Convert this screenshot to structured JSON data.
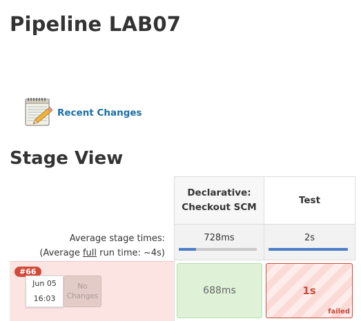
{
  "page": {
    "title": "Pipeline LAB07"
  },
  "recent_changes": {
    "label": "Recent Changes",
    "icon": "notepad-pencil-icon"
  },
  "stage_view": {
    "title": "Stage View",
    "columns": [
      {
        "name_line1": "Declarative:",
        "name_line2": "Checkout SCM",
        "avg": "728ms",
        "avg_bar_fraction": 0.22
      },
      {
        "name_line1": "Test",
        "name_line2": "",
        "avg": "2s",
        "avg_bar_fraction": 1.0
      }
    ],
    "avg_label_line1": "Average stage times:",
    "avg_label_prefix": "(Average ",
    "avg_label_full": "full",
    "avg_label_suffix": " run time: ~4s)",
    "run": {
      "badge": "#66",
      "date": "Jun 05",
      "time": "16:03",
      "no_changes_line1": "No",
      "no_changes_line2": "Changes",
      "cells": [
        {
          "value": "688ms",
          "status": "success"
        },
        {
          "value": "1s",
          "status": "failed",
          "status_label": "failed"
        }
      ]
    }
  },
  "colors": {
    "link": "#1a6ea8",
    "failed": "#d24939",
    "success_bg": "#dff2d8",
    "bar": "#4a7cc7"
  }
}
